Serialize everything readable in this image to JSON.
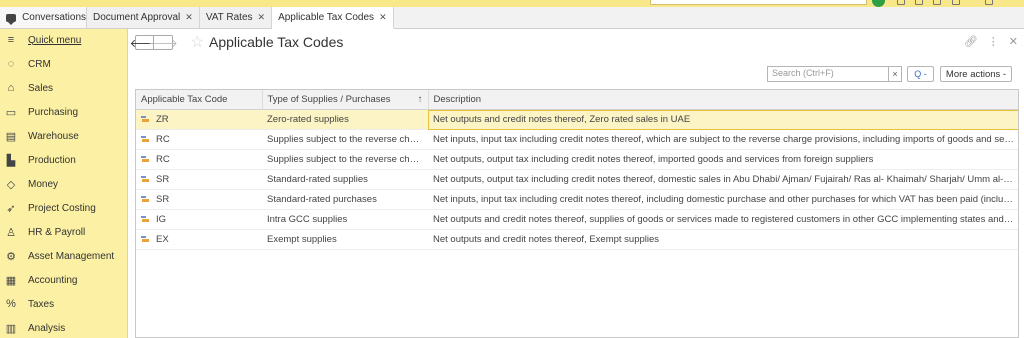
{
  "tabs": {
    "home": "Conversations",
    "items": [
      {
        "label": "Document Approval",
        "active": false
      },
      {
        "label": "VAT Rates",
        "active": false
      },
      {
        "label": "Applicable Tax Codes",
        "active": true
      }
    ]
  },
  "sidebar": {
    "items": [
      {
        "label": "Quick menu",
        "icon": "hamburger-icon"
      },
      {
        "label": "CRM",
        "icon": "crm-icon"
      },
      {
        "label": "Sales",
        "icon": "sales-icon"
      },
      {
        "label": "Purchasing",
        "icon": "truck-icon"
      },
      {
        "label": "Warehouse",
        "icon": "warehouse-icon"
      },
      {
        "label": "Production",
        "icon": "factory-icon"
      },
      {
        "label": "Money",
        "icon": "money-icon"
      },
      {
        "label": "Project Costing",
        "icon": "rocket-icon"
      },
      {
        "label": "HR & Payroll",
        "icon": "person-icon"
      },
      {
        "label": "Asset Management",
        "icon": "assets-icon"
      },
      {
        "label": "Accounting",
        "icon": "calculator-icon"
      },
      {
        "label": "Taxes",
        "icon": "percent-icon"
      },
      {
        "label": "Analysis",
        "icon": "bar-chart-icon"
      }
    ]
  },
  "page": {
    "title": "Applicable Tax Codes"
  },
  "toolbar": {
    "search_placeholder": "Search (Ctrl+F)",
    "clear_label": "×",
    "search_label": "Q -",
    "more_actions_label": "More actions -"
  },
  "table": {
    "columns": [
      "Applicable Tax Code",
      "Type of Supplies / Purchases",
      "Description"
    ],
    "sort_indicator": "↑",
    "rows": [
      {
        "code": "ZR",
        "type": "Zero-rated supplies",
        "description": "Net outputs and credit notes thereof, Zero rated sales in UAE",
        "selected": true
      },
      {
        "code": "RC",
        "type": "Supplies subject to the reverse charge",
        "description": "Net inputs, input tax including credit notes thereof, which are subject to the reverse charge provisions, including imports of goods and services...",
        "selected": false
      },
      {
        "code": "RC",
        "type": "Supplies subject to the reverse charge",
        "description": "Net outputs, output tax including credit notes thereof, imported goods and services from foreign suppliers",
        "selected": false
      },
      {
        "code": "SR",
        "type": "Standard-rated supplies",
        "description": "Net outputs, output tax including credit notes thereof, domestic sales in Abu Dhabi/ Ajman/ Fujairah/ Ras al- Khaimah/ Sharjah/ Umm al-Quwain",
        "selected": false
      },
      {
        "code": "SR",
        "type": "Standard-rated purchases",
        "description": "Net inputs, input tax including credit notes thereof, including domestic purchase and other purchases for which VAT has been paid (including a...",
        "selected": false
      },
      {
        "code": "IG",
        "type": "Intra GCC supplies",
        "description": "Net outputs and credit notes thereof, supplies of goods or services made to registered customers in other GCC implementing states and for w...",
        "selected": false
      },
      {
        "code": "EX",
        "type": "Exempt supplies",
        "description": "Net outputs and credit notes thereof, Exempt supplies",
        "selected": false
      }
    ]
  }
}
